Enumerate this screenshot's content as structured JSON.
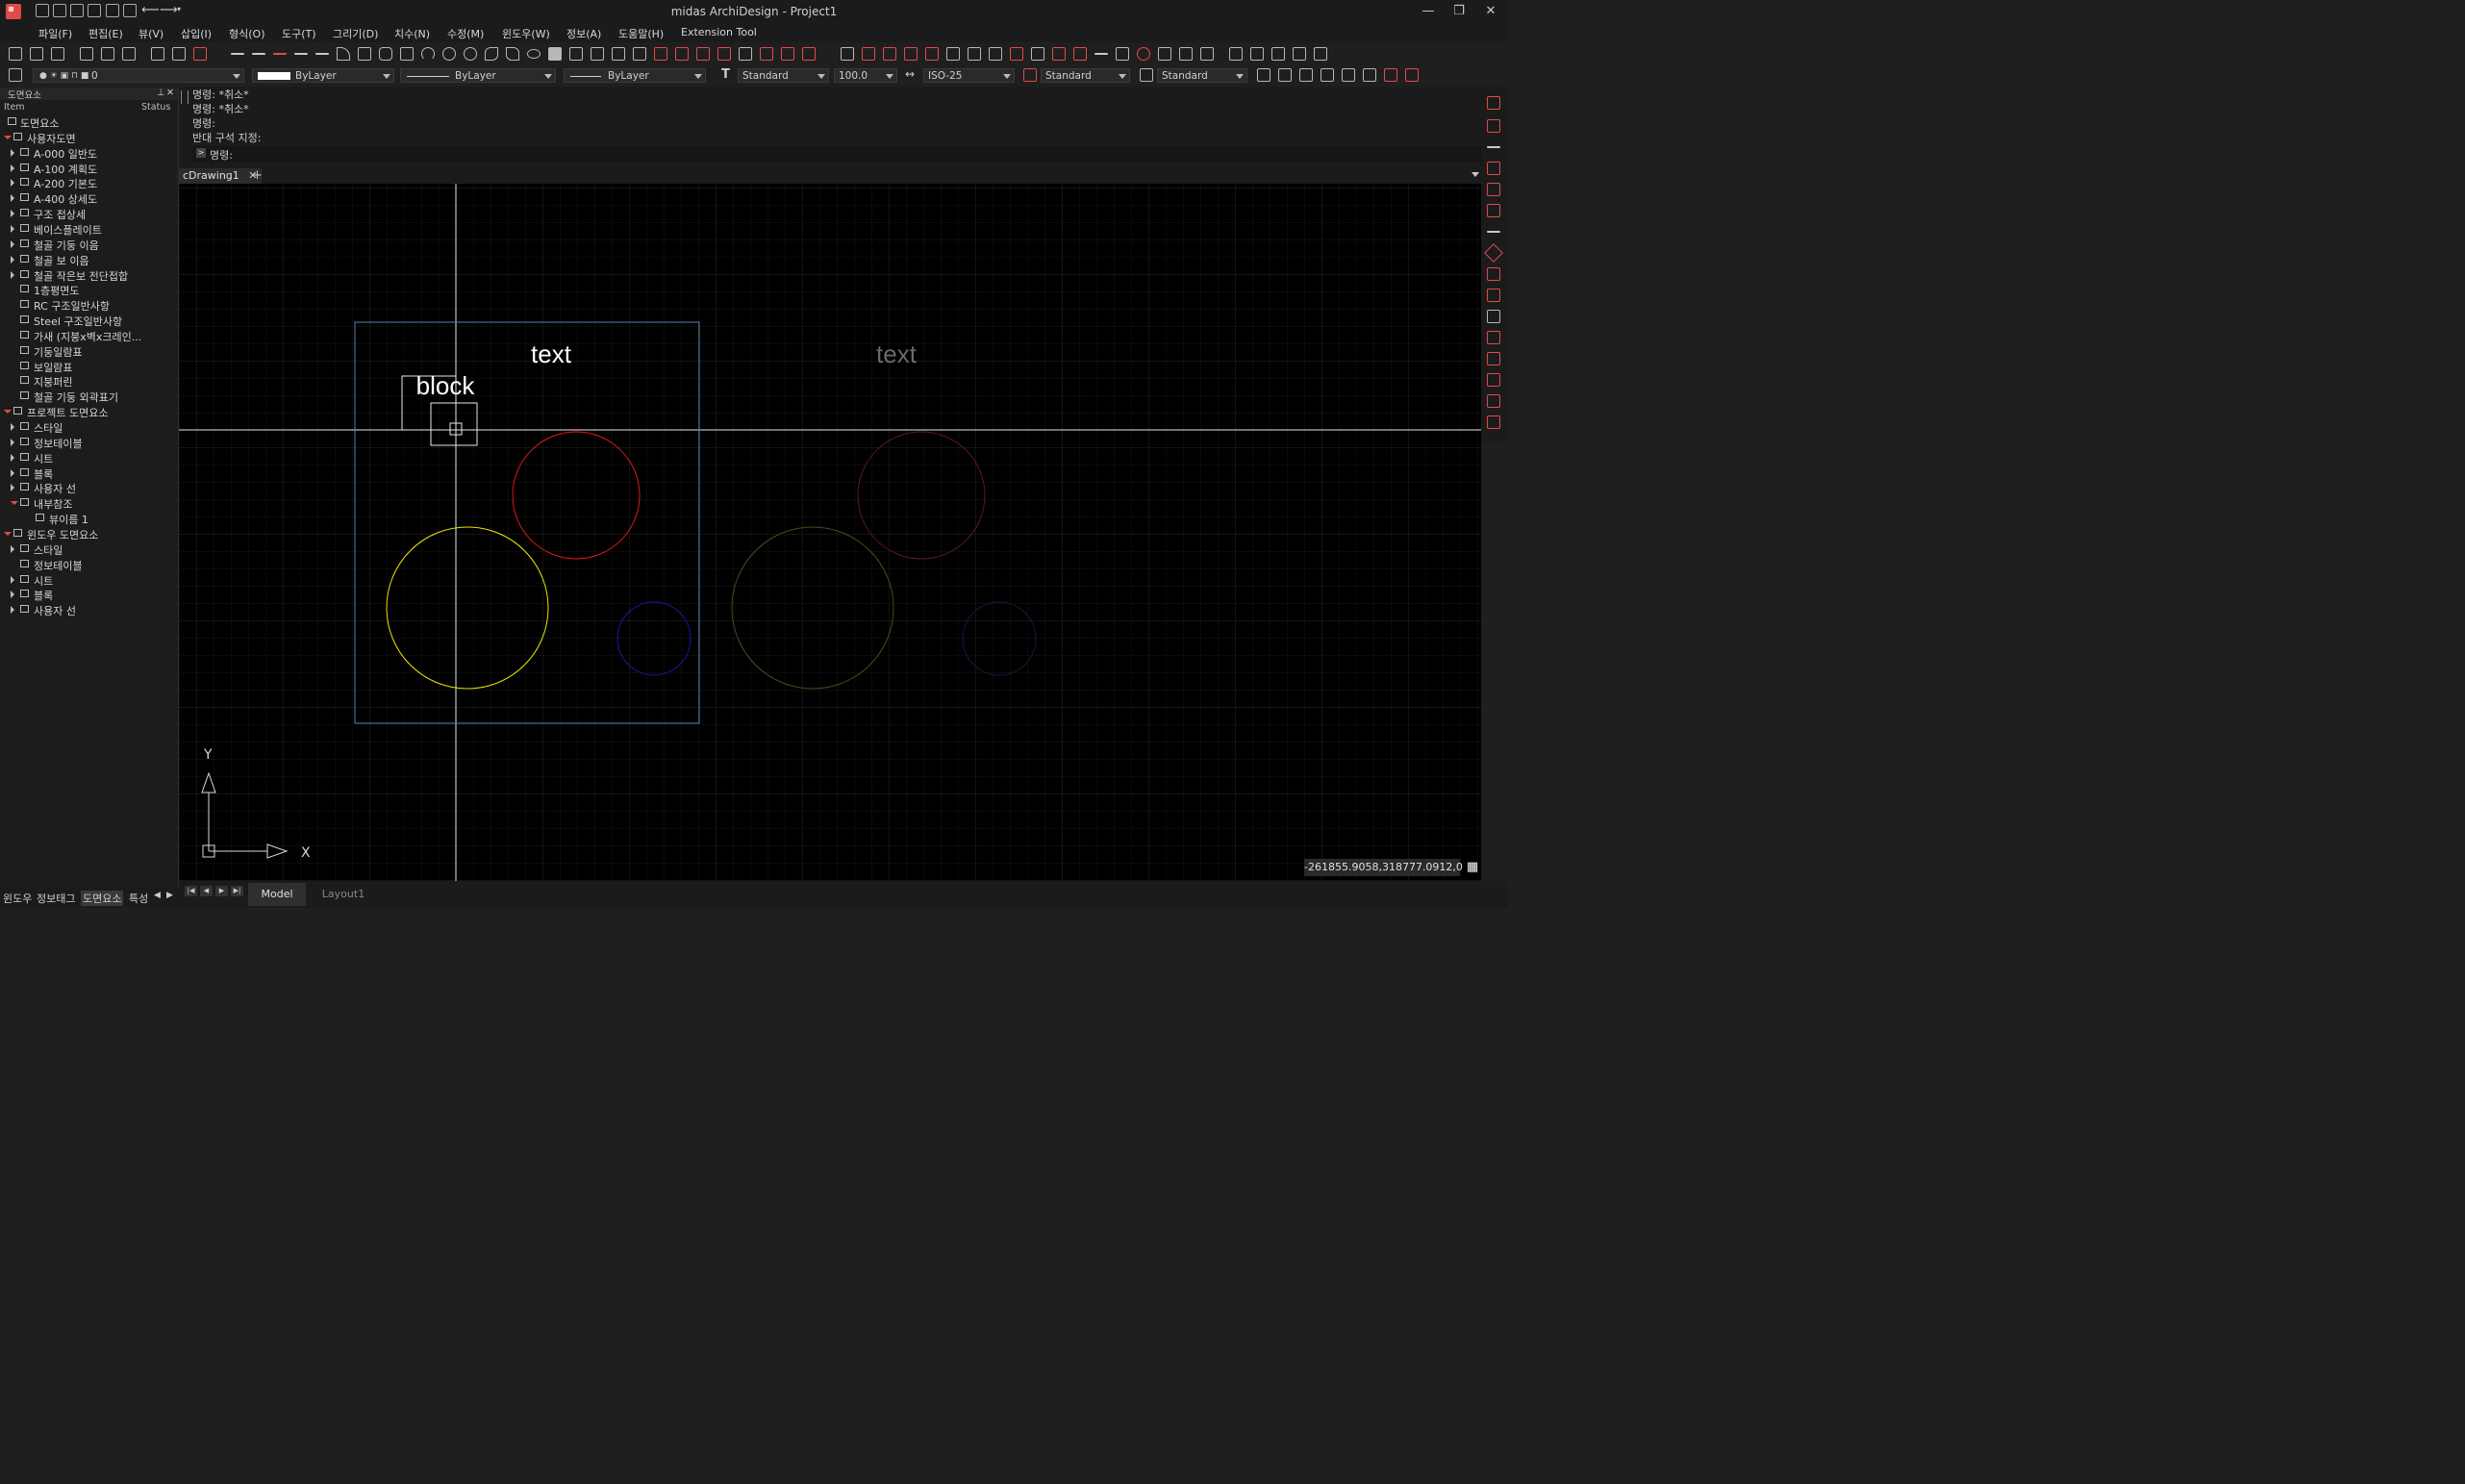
{
  "window": {
    "title": "midas ArchiDesign - Project1",
    "controls": [
      "—",
      "❐",
      "✕"
    ]
  },
  "menu": [
    "파일(F)",
    "편집(E)",
    "뷰(V)",
    "삽입(I)",
    "형식(O)",
    "도구(T)",
    "그리기(D)",
    "치수(N)",
    "수정(M)",
    "윈도우(W)",
    "정보(A)",
    "도움말(H)",
    "Extension Tool"
  ],
  "properties_bar": {
    "layer": "0",
    "color": "ByLayer",
    "linetype": "ByLayer",
    "lineweight": "ByLayer",
    "text_style": "Standard",
    "scale": "100.0",
    "dim_style": "ISO-25",
    "multileader_style": "Standard",
    "table_style": "Standard"
  },
  "left_panel": {
    "title": "도면요소",
    "col_item": "Item",
    "col_status": "Status",
    "tree": [
      {
        "label": "도면요소",
        "level": 0,
        "exp": "none",
        "icon": "sheet-set-icon"
      },
      {
        "label": "사용자도면",
        "level": 0,
        "exp": "open",
        "icon": "folder-icon"
      },
      {
        "label": "A-000 일반도",
        "level": 1,
        "exp": "closed",
        "icon": "folder-icon"
      },
      {
        "label": "A-100 계획도",
        "level": 1,
        "exp": "closed",
        "icon": "folder-icon"
      },
      {
        "label": "A-200 기본도",
        "level": 1,
        "exp": "closed",
        "icon": "folder-icon"
      },
      {
        "label": "A-400 상세도",
        "level": 1,
        "exp": "closed",
        "icon": "folder-icon"
      },
      {
        "label": "구조 접상세",
        "level": 1,
        "exp": "closed",
        "icon": "folder-icon"
      },
      {
        "label": "베이스플레이트",
        "level": 1,
        "exp": "closed",
        "icon": "folder-icon"
      },
      {
        "label": "철골 기둥 이음",
        "level": 1,
        "exp": "closed",
        "icon": "folder-icon"
      },
      {
        "label": "철골 보 이음",
        "level": 1,
        "exp": "closed",
        "icon": "folder-icon"
      },
      {
        "label": "철골 작은보 전단접합",
        "level": 1,
        "exp": "closed",
        "icon": "folder-icon"
      },
      {
        "label": "1층평면도",
        "level": 1,
        "exp": "none",
        "icon": "drawing-icon"
      },
      {
        "label": "RC 구조일반사항",
        "level": 1,
        "exp": "none",
        "icon": "drawing-icon"
      },
      {
        "label": "Steel 구조일반사항",
        "level": 1,
        "exp": "none",
        "icon": "drawing-icon"
      },
      {
        "label": "가새 (지붕x벽x크레인...",
        "level": 1,
        "exp": "none",
        "icon": "drawing-icon"
      },
      {
        "label": "기둥일람표",
        "level": 1,
        "exp": "none",
        "icon": "drawing-icon"
      },
      {
        "label": "보일람표",
        "level": 1,
        "exp": "none",
        "icon": "drawing-icon"
      },
      {
        "label": "지붕퍼린",
        "level": 1,
        "exp": "none",
        "icon": "drawing-icon"
      },
      {
        "label": "철골 기둥 외곽표기",
        "level": 1,
        "exp": "none",
        "icon": "drawing-icon"
      },
      {
        "label": "프로젝트 도면요소",
        "level": 0,
        "exp": "open",
        "icon": "project-icon"
      },
      {
        "label": "스타일",
        "level": 1,
        "exp": "closed",
        "icon": "style-icon"
      },
      {
        "label": "정보테이블",
        "level": 1,
        "exp": "closed",
        "icon": "table-icon"
      },
      {
        "label": "시트",
        "level": 1,
        "exp": "closed",
        "icon": "sheet-icon"
      },
      {
        "label": "블록",
        "level": 1,
        "exp": "closed",
        "icon": "block-icon"
      },
      {
        "label": "사용자 선",
        "level": 1,
        "exp": "closed",
        "icon": "line-icon"
      },
      {
        "label": "내부참조",
        "level": 1,
        "exp": "open",
        "icon": "xref-icon"
      },
      {
        "label": "뷰이름 1",
        "level": 2,
        "exp": "none",
        "icon": "view-icon"
      },
      {
        "label": "윈도우 도면요소",
        "level": 0,
        "exp": "open",
        "icon": "window-icon"
      },
      {
        "label": "스타일",
        "level": 1,
        "exp": "closed",
        "icon": "style-icon"
      },
      {
        "label": "정보테이블",
        "level": 1,
        "exp": "none",
        "icon": "table-icon"
      },
      {
        "label": "시트",
        "level": 1,
        "exp": "closed",
        "icon": "sheet-icon"
      },
      {
        "label": "블록",
        "level": 1,
        "exp": "closed",
        "icon": "block-icon"
      },
      {
        "label": "사용자 선",
        "level": 1,
        "exp": "closed",
        "icon": "line-icon"
      }
    ],
    "tabs": [
      "윈도우",
      "정보태그",
      "도면요소",
      "특성"
    ],
    "active_tab": "도면요소"
  },
  "command": {
    "history": [
      "명령: *취소*",
      "명령: *취소*",
      "명령:",
      "반대 구석 지정:"
    ],
    "prompt": "명령:"
  },
  "doc_tab": "cDrawing1",
  "canvas": {
    "text_left": "text",
    "text_right": "text",
    "block_label": "block",
    "axis_x": "X",
    "axis_y": "Y",
    "colors": {
      "frame": "#5a7fb0",
      "red": "#e0161a",
      "yellow": "#e6e000",
      "blue": "#1a1aa8",
      "faded_red": "#5a1a1a",
      "faded_yellow": "#4a4a1a",
      "faded_blue": "#1a1a4a"
    }
  },
  "bottom_tabs": {
    "model": "Model",
    "layout": "Layout1"
  },
  "coords": "-261855.9058,318777.0912,0"
}
